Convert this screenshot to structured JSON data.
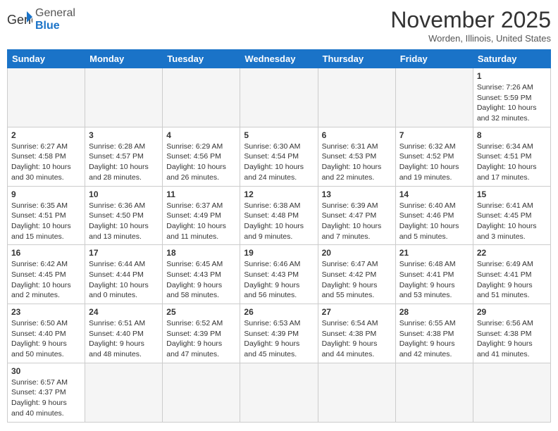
{
  "logo": {
    "text_general": "General",
    "text_blue": "Blue"
  },
  "title": {
    "month_year": "November 2025",
    "location": "Worden, Illinois, United States"
  },
  "days_of_week": [
    "Sunday",
    "Monday",
    "Tuesday",
    "Wednesday",
    "Thursday",
    "Friday",
    "Saturday"
  ],
  "weeks": [
    [
      {
        "day": "",
        "info": ""
      },
      {
        "day": "",
        "info": ""
      },
      {
        "day": "",
        "info": ""
      },
      {
        "day": "",
        "info": ""
      },
      {
        "day": "",
        "info": ""
      },
      {
        "day": "",
        "info": ""
      },
      {
        "day": "1",
        "info": "Sunrise: 7:26 AM\nSunset: 5:59 PM\nDaylight: 10 hours and 32 minutes."
      }
    ],
    [
      {
        "day": "2",
        "info": "Sunrise: 6:27 AM\nSunset: 4:58 PM\nDaylight: 10 hours and 30 minutes."
      },
      {
        "day": "3",
        "info": "Sunrise: 6:28 AM\nSunset: 4:57 PM\nDaylight: 10 hours and 28 minutes."
      },
      {
        "day": "4",
        "info": "Sunrise: 6:29 AM\nSunset: 4:56 PM\nDaylight: 10 hours and 26 minutes."
      },
      {
        "day": "5",
        "info": "Sunrise: 6:30 AM\nSunset: 4:54 PM\nDaylight: 10 hours and 24 minutes."
      },
      {
        "day": "6",
        "info": "Sunrise: 6:31 AM\nSunset: 4:53 PM\nDaylight: 10 hours and 22 minutes."
      },
      {
        "day": "7",
        "info": "Sunrise: 6:32 AM\nSunset: 4:52 PM\nDaylight: 10 hours and 19 minutes."
      },
      {
        "day": "8",
        "info": "Sunrise: 6:34 AM\nSunset: 4:51 PM\nDaylight: 10 hours and 17 minutes."
      }
    ],
    [
      {
        "day": "9",
        "info": "Sunrise: 6:35 AM\nSunset: 4:51 PM\nDaylight: 10 hours and 15 minutes."
      },
      {
        "day": "10",
        "info": "Sunrise: 6:36 AM\nSunset: 4:50 PM\nDaylight: 10 hours and 13 minutes."
      },
      {
        "day": "11",
        "info": "Sunrise: 6:37 AM\nSunset: 4:49 PM\nDaylight: 10 hours and 11 minutes."
      },
      {
        "day": "12",
        "info": "Sunrise: 6:38 AM\nSunset: 4:48 PM\nDaylight: 10 hours and 9 minutes."
      },
      {
        "day": "13",
        "info": "Sunrise: 6:39 AM\nSunset: 4:47 PM\nDaylight: 10 hours and 7 minutes."
      },
      {
        "day": "14",
        "info": "Sunrise: 6:40 AM\nSunset: 4:46 PM\nDaylight: 10 hours and 5 minutes."
      },
      {
        "day": "15",
        "info": "Sunrise: 6:41 AM\nSunset: 4:45 PM\nDaylight: 10 hours and 3 minutes."
      }
    ],
    [
      {
        "day": "16",
        "info": "Sunrise: 6:42 AM\nSunset: 4:45 PM\nDaylight: 10 hours and 2 minutes."
      },
      {
        "day": "17",
        "info": "Sunrise: 6:44 AM\nSunset: 4:44 PM\nDaylight: 10 hours and 0 minutes."
      },
      {
        "day": "18",
        "info": "Sunrise: 6:45 AM\nSunset: 4:43 PM\nDaylight: 9 hours and 58 minutes."
      },
      {
        "day": "19",
        "info": "Sunrise: 6:46 AM\nSunset: 4:43 PM\nDaylight: 9 hours and 56 minutes."
      },
      {
        "day": "20",
        "info": "Sunrise: 6:47 AM\nSunset: 4:42 PM\nDaylight: 9 hours and 55 minutes."
      },
      {
        "day": "21",
        "info": "Sunrise: 6:48 AM\nSunset: 4:41 PM\nDaylight: 9 hours and 53 minutes."
      },
      {
        "day": "22",
        "info": "Sunrise: 6:49 AM\nSunset: 4:41 PM\nDaylight: 9 hours and 51 minutes."
      }
    ],
    [
      {
        "day": "23",
        "info": "Sunrise: 6:50 AM\nSunset: 4:40 PM\nDaylight: 9 hours and 50 minutes."
      },
      {
        "day": "24",
        "info": "Sunrise: 6:51 AM\nSunset: 4:40 PM\nDaylight: 9 hours and 48 minutes."
      },
      {
        "day": "25",
        "info": "Sunrise: 6:52 AM\nSunset: 4:39 PM\nDaylight: 9 hours and 47 minutes."
      },
      {
        "day": "26",
        "info": "Sunrise: 6:53 AM\nSunset: 4:39 PM\nDaylight: 9 hours and 45 minutes."
      },
      {
        "day": "27",
        "info": "Sunrise: 6:54 AM\nSunset: 4:38 PM\nDaylight: 9 hours and 44 minutes."
      },
      {
        "day": "28",
        "info": "Sunrise: 6:55 AM\nSunset: 4:38 PM\nDaylight: 9 hours and 42 minutes."
      },
      {
        "day": "29",
        "info": "Sunrise: 6:56 AM\nSunset: 4:38 PM\nDaylight: 9 hours and 41 minutes."
      }
    ],
    [
      {
        "day": "30",
        "info": "Sunrise: 6:57 AM\nSunset: 4:37 PM\nDaylight: 9 hours and 40 minutes."
      },
      {
        "day": "",
        "info": ""
      },
      {
        "day": "",
        "info": ""
      },
      {
        "day": "",
        "info": ""
      },
      {
        "day": "",
        "info": ""
      },
      {
        "day": "",
        "info": ""
      },
      {
        "day": "",
        "info": ""
      }
    ]
  ]
}
